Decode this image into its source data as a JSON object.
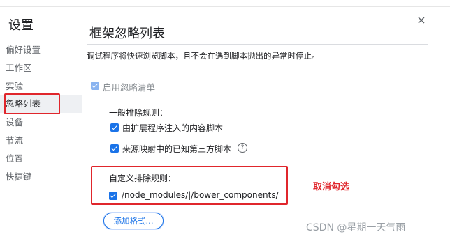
{
  "sidebar": {
    "title": "设置",
    "items": [
      {
        "label": "偏好设置",
        "selected": false
      },
      {
        "label": "工作区",
        "selected": false
      },
      {
        "label": "实验",
        "selected": false
      },
      {
        "label": "忽略列表",
        "selected": true
      },
      {
        "label": "设备",
        "selected": false
      },
      {
        "label": "节流",
        "selected": false
      },
      {
        "label": "位置",
        "selected": false
      },
      {
        "label": "快捷键",
        "selected": false
      }
    ]
  },
  "main": {
    "title": "框架忽略列表",
    "close_icon": "×",
    "description": "调试程序将快速浏览脚本，且不会在遇到脚本抛出的异常时停止。",
    "enable_ignore_list": {
      "label": "启用忽略清单",
      "checked": true
    },
    "general_rules": {
      "heading": "一般排除规则：",
      "items": [
        {
          "label": "由扩展程序注入的内容脚本",
          "checked": true
        },
        {
          "label": "来源映射中的已知第三方脚本",
          "checked": true,
          "help_icon": "?"
        }
      ]
    },
    "custom_rules": {
      "heading": "自定义排除规则：",
      "items": [
        {
          "label": "/node_modules/|/bower_components/",
          "checked": true
        }
      ]
    },
    "add_pattern_button": "添加格式..."
  },
  "annotation": {
    "text": "取消勾选",
    "color": "#e0262c"
  },
  "watermark": "CSDN @星期一天气雨",
  "colors": {
    "accent": "#1a73e8",
    "annotation_red": "#e0262c",
    "selected_bg": "#eef0f3"
  }
}
